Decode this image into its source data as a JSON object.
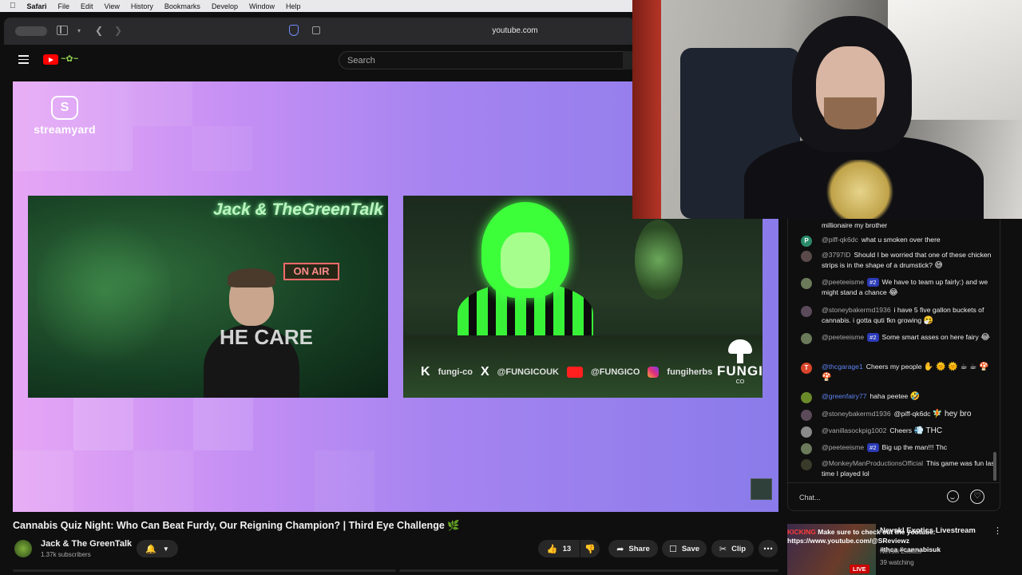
{
  "menubar": {
    "app": "Safari",
    "items": [
      "File",
      "Edit",
      "View",
      "History",
      "Bookmarks",
      "Develop",
      "Window",
      "Help"
    ]
  },
  "browser": {
    "url": "youtube.com"
  },
  "masthead": {
    "search_placeholder": "Search"
  },
  "player": {
    "watermark": "streamyard",
    "left_cam": {
      "neon_sign": "Jack & TheGreenTalk",
      "on_air": "ON AIR",
      "shirt_text": "HE CARE"
    },
    "right_cam": {
      "brand": "FUNGI",
      "brand_sub": "CO",
      "socials": [
        "fungi-co",
        "@FUNGICOUK",
        "@FUNGICO",
        "fungiherbs"
      ]
    }
  },
  "chat": {
    "messages": [
      {
        "author": "",
        "text": "millionaire my brother",
        "emoji": "",
        "badge": "",
        "avatar": "",
        "avatar_color": "#0f0f0f"
      },
      {
        "author": "@piff-qk6dc",
        "text": "what u smoken over there",
        "emoji": "",
        "badge": "",
        "avatar": "P",
        "avatar_color": "#2a8a6a"
      },
      {
        "author": "@3797ID",
        "text": "Should I be worried that one of these chicken strips is in the shape of a drumstick?",
        "emoji": "😅",
        "badge": "",
        "avatar": "",
        "avatar_color": "#5a4a4a"
      },
      {
        "author": "@peeteeisme",
        "text": "We have to team up fairly:) and we might stand a chance",
        "emoji": "😂",
        "badge": "#2",
        "avatar": "",
        "avatar_color": "#6a7a5a"
      },
      {
        "author": "@stoneybakermd1936",
        "text": "i have 5 five gallon buckets of cannabis. i gotta quti fkn growing",
        "emoji": "🤧",
        "badge": "",
        "avatar": "",
        "avatar_color": "#5a4a5a"
      },
      {
        "author": "@peeteeisme",
        "text": "Some smart asses on here fairy",
        "emoji": "😂",
        "badge": "#2",
        "avatar": "",
        "avatar_color": "#6a7a5a"
      },
      {
        "author": "@thcgarage1",
        "text": "Cheers my people",
        "emoji": "✋ 🌞 🌞 ☕ ☕ 🍄 🍄",
        "badge": "",
        "avatar": "T",
        "avatar_color": "#d9452a"
      },
      {
        "author": "@greenfairy77",
        "text": "haha peetee",
        "emoji": "🤣",
        "badge": "",
        "avatar": "",
        "avatar_color": "#6a8a2a"
      },
      {
        "author": "@stoneybakermd1936",
        "text": "@piff-qk6dc",
        "emoji": "🧚 hey bro",
        "badge": "",
        "avatar": "",
        "avatar_color": "#5a4a5a"
      },
      {
        "author": "@vanillasockpig1002",
        "text": "Cheers",
        "emoji": "💨 THC",
        "badge": "",
        "avatar": "",
        "avatar_color": "#8a8a8a"
      },
      {
        "author": "@peeteeisme",
        "text": "Big up the man!!! Thc",
        "emoji": "",
        "badge": "#2",
        "avatar": "",
        "avatar_color": "#6a7a5a"
      },
      {
        "author": "@MonkeyManProductionsOfficial",
        "text": "This game was fun last time I played lol",
        "emoji": "",
        "badge": "",
        "avatar": "",
        "avatar_color": "#3a3a2a"
      }
    ],
    "input_placeholder": "Chat..."
  },
  "video": {
    "title": "Cannabis Quiz Night: Who Can Beat Furdy, Our Reigning Champion? | Third Eye Challenge 🌿",
    "channel": "Jack & The GreenTalk",
    "subscribers": "1.37k subscribers",
    "likes": "13",
    "share_label": "Share",
    "save_label": "Save",
    "clip_label": "Clip"
  },
  "recommendation": {
    "overlay_line1_red": "KICKING",
    "overlay_line1": "Make sure to check out the youtube:",
    "overlay_line2": "https://www.youtube.com/@SReviewz",
    "overlay_line3": "#thca #cannabisuk",
    "title": "Nevskl Exotics Livestream",
    "title_suffix": "Thca & cannabisuk ...",
    "channel": "Nevski Exotics",
    "watching": "39 watching",
    "live_label": "LIVE"
  }
}
